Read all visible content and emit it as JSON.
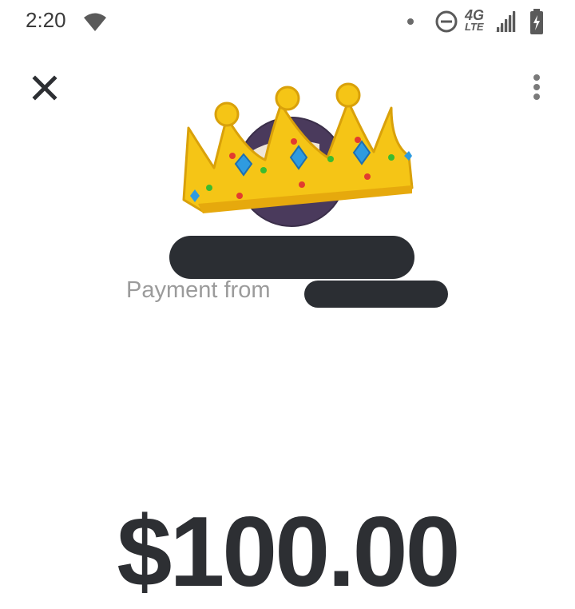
{
  "status_bar": {
    "time": "2:20",
    "network_type": "4G",
    "network_sub": "LTE",
    "icons": [
      "wifi-icon",
      "notification-dot-icon",
      "do-not-disturb-icon",
      "cellular-signal-icon",
      "battery-charging-icon"
    ]
  },
  "toolbar": {
    "close_icon": "close-icon",
    "more_icon": "more-vertical-icon"
  },
  "payment": {
    "from_label": "Payment from",
    "amount": "$100.00"
  },
  "colors": {
    "background": "#ffffff",
    "text_dark": "#2d2f33",
    "text_muted": "#9b9b9b",
    "redaction": "#2b2e33",
    "crown_gold": "#f5c516"
  }
}
